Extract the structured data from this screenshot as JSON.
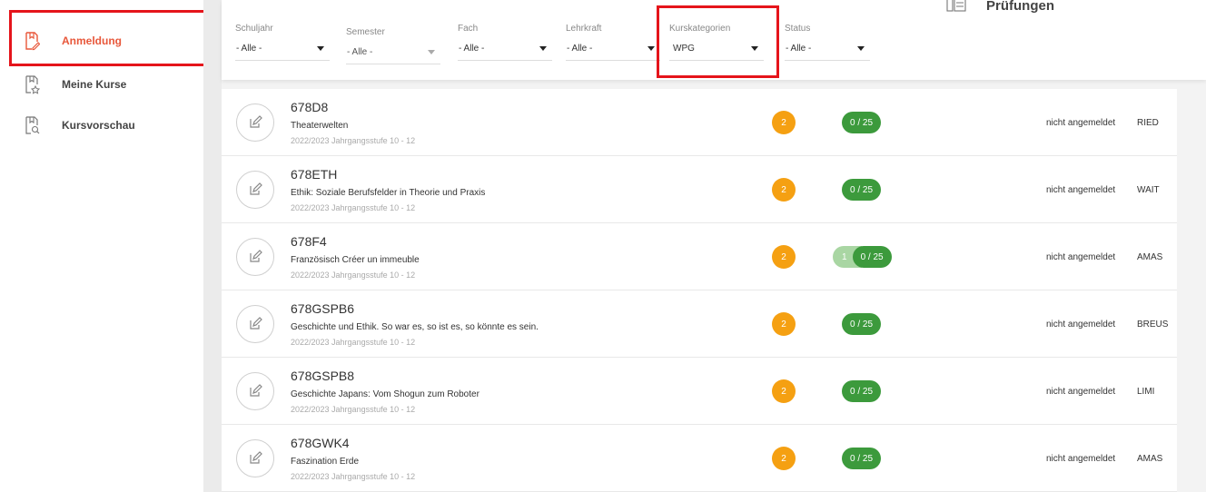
{
  "sidebar": {
    "items": [
      {
        "label": "Anmeldung",
        "icon": "register-icon",
        "active": true
      },
      {
        "label": "Meine Kurse",
        "icon": "my-courses-icon"
      },
      {
        "label": "Kursvorschau",
        "icon": "course-preview-icon"
      }
    ]
  },
  "header": {
    "pruefungen_label": "Prüfungen",
    "pruefungen_icon": "exam-list-icon"
  },
  "filters": {
    "schuljahr": {
      "label": "Schuljahr",
      "value": "- Alle -"
    },
    "semester": {
      "label": "Semester",
      "value": "- Alle -"
    },
    "fach": {
      "label": "Fach",
      "value": "- Alle -"
    },
    "lehrkraft": {
      "label": "Lehrkraft",
      "value": "- Alle -"
    },
    "kurskategorien": {
      "label": "Kurskategorien",
      "value": "WPG"
    },
    "status": {
      "label": "Status",
      "value": "- Alle -"
    }
  },
  "courses": [
    {
      "code": "678D8",
      "title": "Theaterwelten",
      "sub": "2022/2023 Jahrgangsstufe 10 - 12",
      "badge": "2",
      "capacity": "0 / 25",
      "pending": "",
      "status": "nicht angemeldet",
      "teacher": "RIED"
    },
    {
      "code": "678ETH",
      "title": "Ethik: Soziale Berufsfelder in Theorie und Praxis",
      "sub": "2022/2023 Jahrgangsstufe 10 - 12",
      "badge": "2",
      "capacity": "0 / 25",
      "pending": "",
      "status": "nicht angemeldet",
      "teacher": "WAIT"
    },
    {
      "code": "678F4",
      "title": "Französisch Créer un immeuble",
      "sub": "2022/2023 Jahrgangsstufe 10 - 12",
      "badge": "2",
      "capacity": "0 / 25",
      "pending": "1",
      "status": "nicht angemeldet",
      "teacher": "AMAS"
    },
    {
      "code": "678GSPB6",
      "title": "Geschichte und Ethik. So war es, so ist es, so könnte es sein.",
      "sub": "2022/2023 Jahrgangsstufe 10 - 12",
      "badge": "2",
      "capacity": "0 / 25",
      "pending": "",
      "status": "nicht angemeldet",
      "teacher": "BREUS"
    },
    {
      "code": "678GSPB8",
      "title": "Geschichte Japans: Vom Shogun zum Roboter",
      "sub": "2022/2023 Jahrgangsstufe 10 - 12",
      "badge": "2",
      "capacity": "0 / 25",
      "pending": "",
      "status": "nicht angemeldet",
      "teacher": "LIMI"
    },
    {
      "code": "678GWK4",
      "title": "Faszination Erde",
      "sub": "2022/2023 Jahrgangsstufe 10 - 12",
      "badge": "2",
      "capacity": "0 / 25",
      "pending": "",
      "status": "nicht angemeldet",
      "teacher": "AMAS"
    }
  ],
  "colors": {
    "accent": "#e8573a",
    "highlight": "#e5141b",
    "badge": "#f5a012",
    "capacity": "#3c9a3c",
    "pending": "#a9d6a3"
  }
}
